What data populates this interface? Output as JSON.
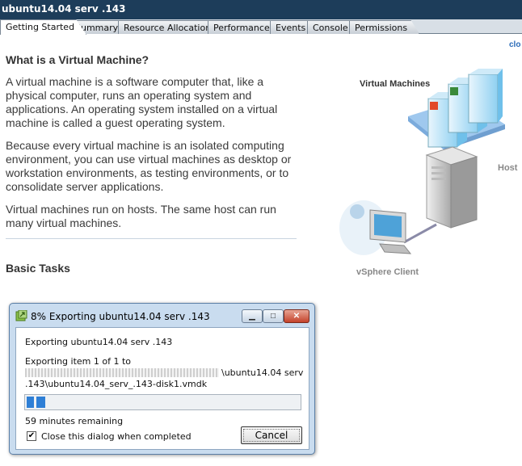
{
  "window": {
    "title": "ubuntu14.04 serv .143"
  },
  "tabs": [
    {
      "label": "Getting Started"
    },
    {
      "label": "Summary"
    },
    {
      "label": "Resource Allocation"
    },
    {
      "label": "Performance"
    },
    {
      "label": "Events"
    },
    {
      "label": "Console"
    },
    {
      "label": "Permissions"
    }
  ],
  "close_link": "clo",
  "main": {
    "heading": "What is a Virtual Machine?",
    "paragraphs": [
      "A virtual machine is a software computer that, like a physical computer, runs an operating system and applications. An operating system installed on a virtual machine is called a guest operating system.",
      "Because every virtual machine is an isolated computing environment, you can use virtual machines as desktop or workstation environments, as testing environments, or to consolidate server applications.",
      "Virtual machines run on hosts. The same host can run many virtual machines."
    ],
    "basic_tasks": "Basic Tasks"
  },
  "diagram": {
    "vm_label": "Virtual Machines",
    "host_label": "Host",
    "client_label": "vSphere Client"
  },
  "dialog": {
    "title": "8% Exporting ubuntu14.04 serv .143",
    "exporting_line": "Exporting ubuntu14.04 serv .143",
    "item_line": "Exporting item 1 of 1 to",
    "path_line1": "\\ubuntu14.04 serv",
    "path_line2": ".143\\ubuntu14.04_serv_.143-disk1.vmdk",
    "progress": 0.08,
    "time_remaining": "59 minutes remaining",
    "checkbox_label": "Close this dialog when completed",
    "checkbox_checked": true,
    "cancel_label": "Cancel",
    "min_symbol": "▁",
    "max_symbol": "□",
    "close_symbol": "✕"
  }
}
